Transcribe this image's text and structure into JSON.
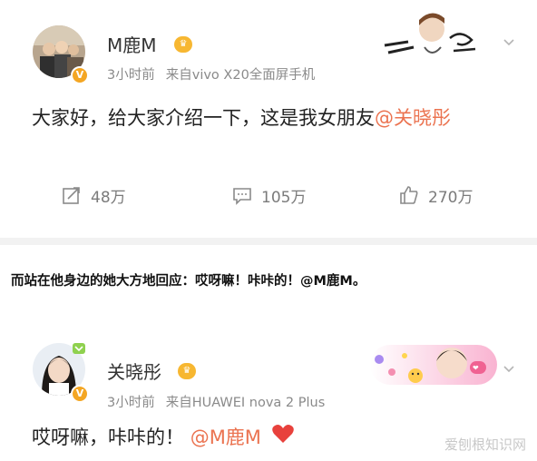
{
  "post1": {
    "username": "M鹿M",
    "time": "3小时前",
    "source": "来自vivo X20全面屏手机",
    "content_text": "大家好，给大家介绍一下，这是我女朋友",
    "content_mention": "@关晓彤",
    "actions": {
      "repost_count": "48万",
      "comment_count": "105万",
      "like_count": "270万"
    }
  },
  "narration": "而站在他身边的她大方地回应：哎呀嘛！咔咔的！@M鹿M。",
  "post2": {
    "username": "关晓彤",
    "time": "3小时前",
    "source": "来自HUAWEI nova 2 Plus",
    "content_text": "哎呀嘛，咔咔的！",
    "content_mention": "@M鹿M"
  },
  "watermark": "爱刨根知识网",
  "colors": {
    "mention": "#eb7350",
    "meta_gray": "#8a8a8a",
    "verified_badge": "#f4a623",
    "heart": "#e8413c"
  },
  "icons": [
    "chevron-down-icon",
    "repost-icon",
    "comment-icon",
    "like-icon",
    "heart-icon",
    "verified-icon",
    "member-crown-icon"
  ]
}
